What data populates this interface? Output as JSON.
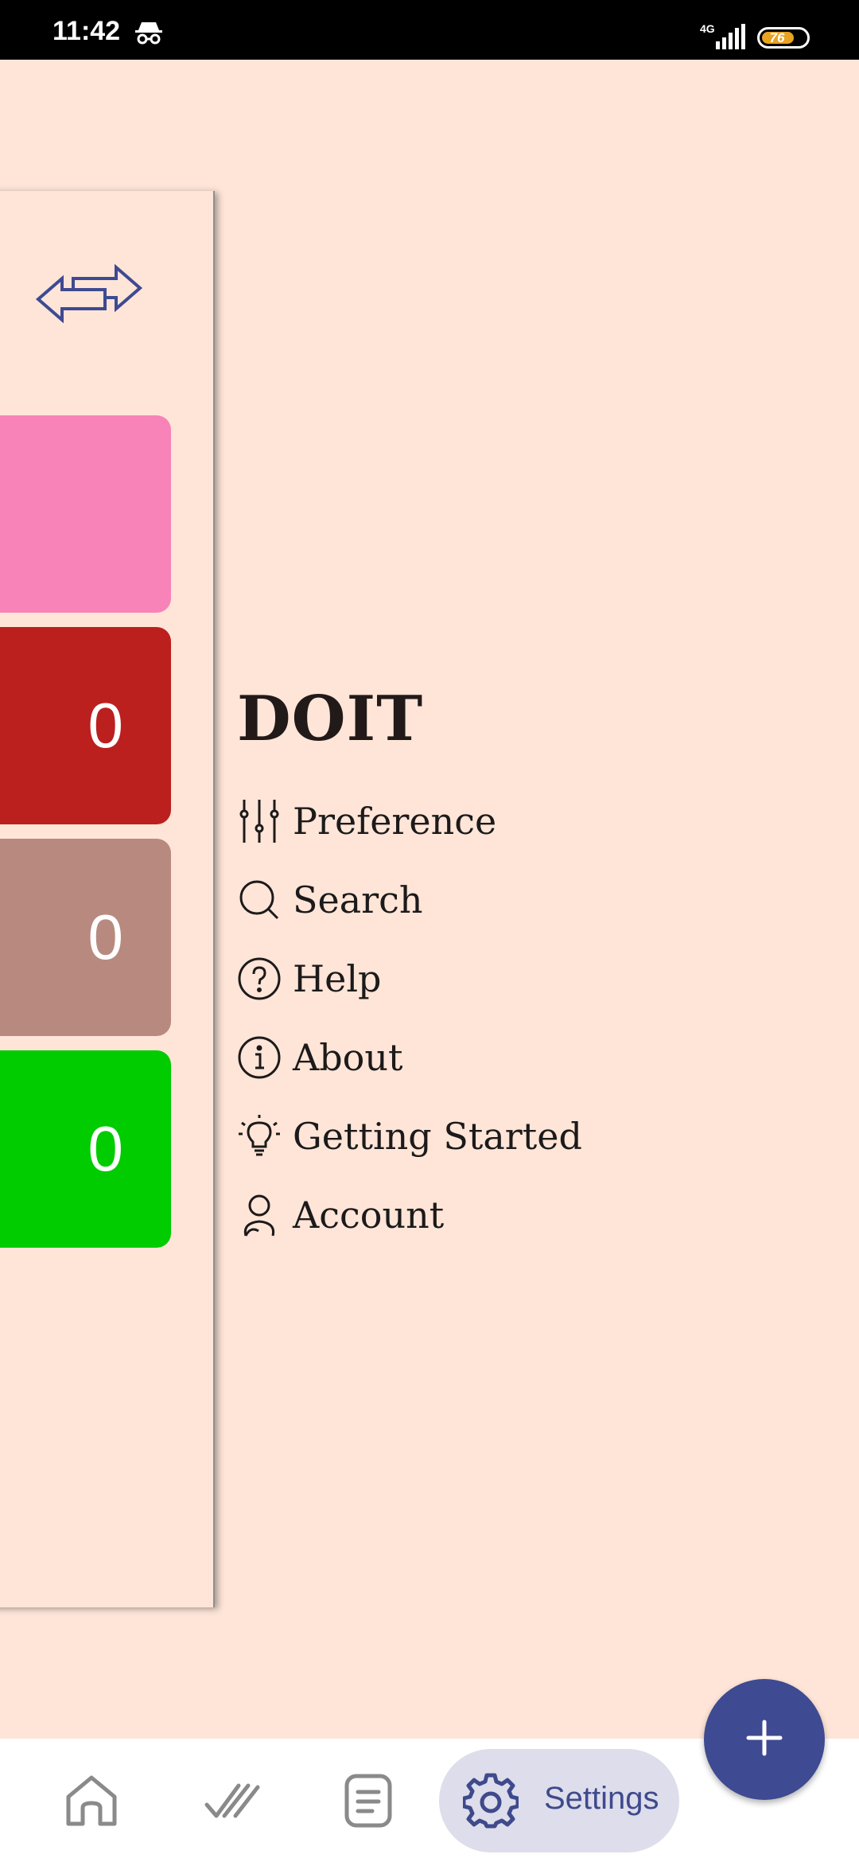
{
  "status_bar": {
    "time": "11:42",
    "network": "4G",
    "battery": "76"
  },
  "panel": {
    "cards": [
      {
        "color": "#F783B8",
        "count": ""
      },
      {
        "color": "#BB201E",
        "count": "0"
      },
      {
        "color": "#B88A7F",
        "count": "0"
      },
      {
        "color": "#00CC00",
        "count": "0"
      }
    ]
  },
  "drawer": {
    "title": "DOIT",
    "items": [
      {
        "label": "Preference",
        "icon": "sliders-icon"
      },
      {
        "label": "Search",
        "icon": "search-icon"
      },
      {
        "label": "Help",
        "icon": "help-icon"
      },
      {
        "label": "About",
        "icon": "info-icon"
      },
      {
        "label": "Getting Started",
        "icon": "lightbulb-icon"
      },
      {
        "label": "Account",
        "icon": "user-icon"
      }
    ]
  },
  "bottom_nav": {
    "settings_label": "Settings"
  },
  "colors": {
    "background": "#FEE5D8",
    "accent": "#3E4A91",
    "pill": "#DDDDEB"
  }
}
